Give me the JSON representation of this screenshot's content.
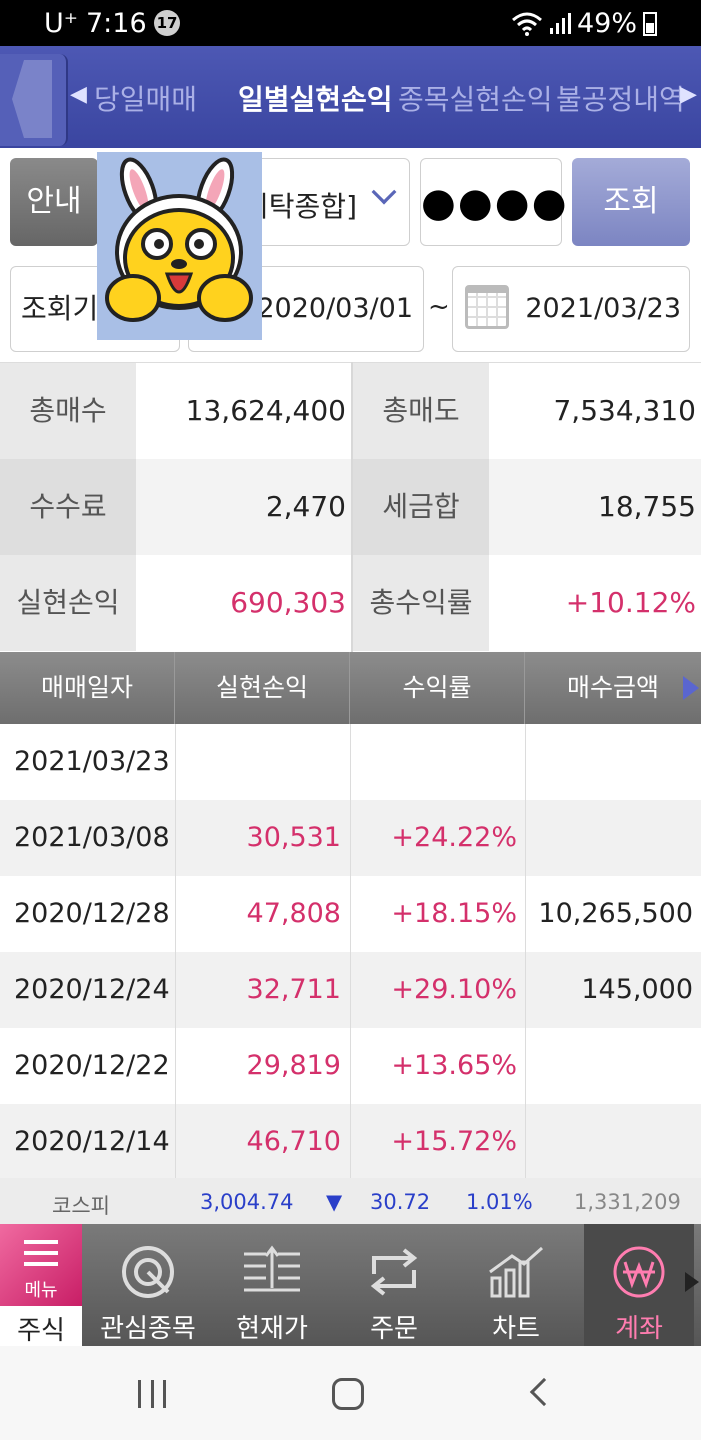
{
  "status_bar": {
    "carrier": "U⁺",
    "time": "7:16",
    "notification_count": "17",
    "battery": "49%"
  },
  "tabs": [
    {
      "label": "당일매매",
      "active": false
    },
    {
      "label": "일별실현손익",
      "active": true
    },
    {
      "label": "종목실현손익",
      "active": false
    },
    {
      "label": "불공정내역",
      "active": false
    }
  ],
  "controls": {
    "guide_label": "안내",
    "account_type": "위탁종합]",
    "password_mask": "●●●●",
    "query_label": "조회",
    "period_label": "조회기",
    "date_from": "2020/03/01",
    "date_separator": "~",
    "date_to": "2021/03/23"
  },
  "summary": {
    "total_buy_label": "총매수",
    "total_buy": "13,624,400",
    "total_sell_label": "총매도",
    "total_sell": "7,534,310",
    "fee_label": "수수료",
    "fee": "2,470",
    "tax_label": "세금합",
    "tax": "18,755",
    "realized_pl_label": "실현손익",
    "realized_pl": "690,303",
    "total_return_label": "총수익률",
    "total_return": "+10.12%"
  },
  "table": {
    "headers": [
      "매매일자",
      "실현손익",
      "수익률",
      "매수금액"
    ],
    "rows": [
      {
        "date": "2021/03/23",
        "pl": "",
        "rate": "",
        "buy": ""
      },
      {
        "date": "2021/03/08",
        "pl": "30,531",
        "rate": "+24.22%",
        "buy": ""
      },
      {
        "date": "2020/12/28",
        "pl": "47,808",
        "rate": "+18.15%",
        "buy": "10,265,500"
      },
      {
        "date": "2020/12/24",
        "pl": "32,711",
        "rate": "+29.10%",
        "buy": "145,000"
      },
      {
        "date": "2020/12/22",
        "pl": "29,819",
        "rate": "+13.65%",
        "buy": ""
      },
      {
        "date": "2020/12/14",
        "pl": "46,710",
        "rate": "+15.72%",
        "buy": ""
      }
    ]
  },
  "ticker": {
    "name": "코스피",
    "price": "3,004.74",
    "direction": "▼",
    "change": "30.72",
    "change_pct": "1.01%",
    "volume": "1,331,209"
  },
  "bottom_nav": {
    "menu_label": "메뉴",
    "stock_label": "주식",
    "items": [
      {
        "label": "관심종목",
        "icon": "watchlist-icon"
      },
      {
        "label": "현재가",
        "icon": "current-price-icon"
      },
      {
        "label": "주문",
        "icon": "order-icon"
      },
      {
        "label": "차트",
        "icon": "chart-icon"
      },
      {
        "label": "계좌",
        "icon": "account-won-icon"
      }
    ]
  },
  "colors": {
    "accent_blue": "#3a45a0",
    "profit_pink": "#d4306b",
    "ticker_blue": "#2a3fc9"
  }
}
